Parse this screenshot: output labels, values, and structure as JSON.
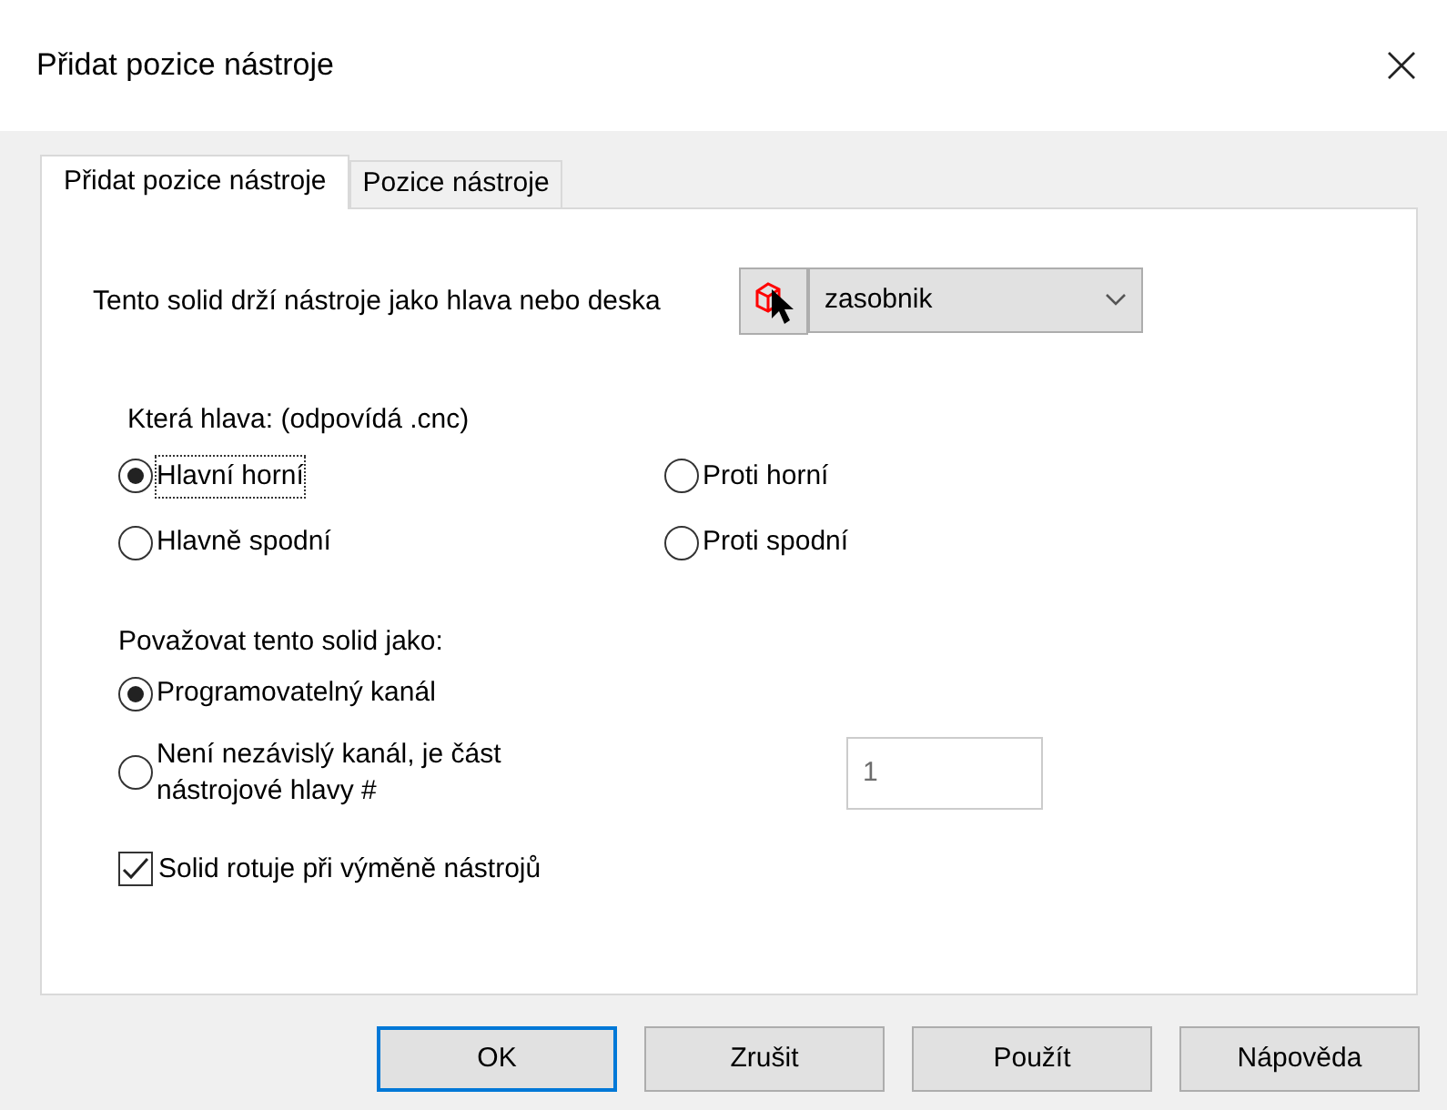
{
  "window": {
    "title": "Přidat pozice nástroje"
  },
  "tabs": [
    {
      "label": "Přidat pozice nástroje",
      "selected": true
    },
    {
      "label": "Pozice nástroje",
      "selected": false
    }
  ],
  "holder": {
    "label": "Tento solid drží nástroje jako hlava nebo deska",
    "dropdown_value": "zasobnik"
  },
  "head_group": {
    "label": "Která hlava: (odpovídá .cnc)",
    "options": [
      {
        "label": "Hlavní horní",
        "selected": true,
        "focused": true
      },
      {
        "label": "Proti horní",
        "selected": false,
        "focused": false
      },
      {
        "label": "Hlavně spodní",
        "selected": false,
        "focused": false
      },
      {
        "label": "Proti spodní",
        "selected": false,
        "focused": false
      }
    ]
  },
  "treat_group": {
    "label": "Považovat tento solid jako:",
    "options": [
      {
        "label": "Programovatelný kanál",
        "selected": true
      },
      {
        "label": "Není nezávislý kanál, je část nástrojové hlavy #",
        "selected": false
      }
    ],
    "head_number": "1"
  },
  "rotate_checkbox": {
    "label": "Solid rotuje při výměně nástrojů",
    "checked": true
  },
  "buttons": [
    {
      "label": "OK",
      "default": true
    },
    {
      "label": "Zrušit",
      "default": false
    },
    {
      "label": "Použít",
      "default": false
    },
    {
      "label": "Nápověda",
      "default": false
    }
  ]
}
